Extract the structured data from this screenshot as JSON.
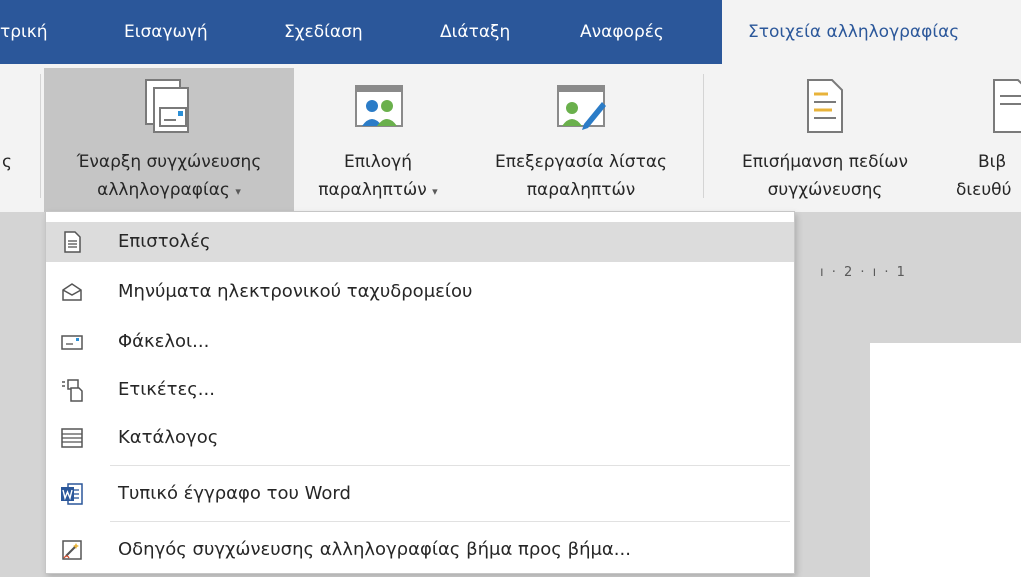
{
  "tabs": [
    {
      "label": "τρική"
    },
    {
      "label": "Εισαγωγή"
    },
    {
      "label": "Σχεδίαση"
    },
    {
      "label": "Διάταξη"
    },
    {
      "label": "Αναφορές"
    },
    {
      "label": "Στοιχεία αλληλογραφίας"
    }
  ],
  "ribbon": {
    "partial_left": "ς",
    "start_merge": {
      "line1": "Έναρξη συγχώνευσης",
      "line2": "αλληλογραφίας",
      "caret": "▾"
    },
    "select_recipients": {
      "line1": "Επιλογή",
      "line2": "παραληπτών",
      "caret": "▾"
    },
    "edit_list": {
      "line1": "Επεξεργασία λίστας",
      "line2": "παραληπτών"
    },
    "highlight_fields": {
      "line1": "Επισήμανση πεδίων",
      "line2": "συγχώνευσης"
    },
    "address_block": {
      "line1": "Βιβ",
      "line2": "διευθύ"
    }
  },
  "ruler": "ı · 2 · ı · 1",
  "menu": {
    "items": [
      {
        "label": "Επιστολές",
        "icon": "letter-icon"
      },
      {
        "label": "Μηνύματα ηλεκτρονικού ταχυδρομείου",
        "icon": "email-envelope-icon"
      },
      {
        "label": "Φάκελοι...",
        "icon": "envelope-icon"
      },
      {
        "label": "Ετικέτες...",
        "icon": "labels-icon"
      },
      {
        "label": "Κατάλογος",
        "icon": "directory-icon"
      },
      {
        "label": "Τυπικό έγγραφο του Word",
        "icon": "word-icon"
      },
      {
        "label": "Οδηγός συγχώνευσης αλληλογραφίας βήμα προς βήμα...",
        "icon": "wizard-icon"
      }
    ]
  },
  "colors": {
    "accent": "#2b579a",
    "ribbon": "#f3f3f3",
    "pressed": "#c5c5c5",
    "word_blue": "#2b579a",
    "people_green": "#6ab04c"
  }
}
